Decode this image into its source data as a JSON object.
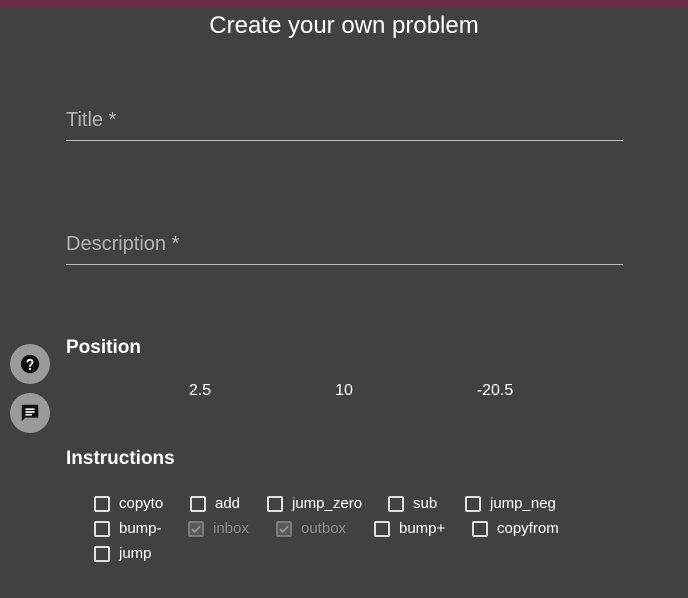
{
  "colors": {
    "accent_bar": "#6b2c49",
    "background": "#414141"
  },
  "page": {
    "title": "Create your own problem"
  },
  "form": {
    "title_placeholder": "Title *",
    "title_value": "",
    "description_placeholder": "Description *",
    "description_value": ""
  },
  "position": {
    "heading": "Position",
    "values": [
      "2.5",
      "10",
      "-20.5"
    ]
  },
  "side_buttons": {
    "help_icon": "help-icon",
    "chat_icon": "chat-icon"
  },
  "instructions": {
    "heading": "Instructions",
    "items": [
      {
        "label": "copyto",
        "checked": false,
        "disabled": false
      },
      {
        "label": "add",
        "checked": false,
        "disabled": false
      },
      {
        "label": "jump_zero",
        "checked": false,
        "disabled": false
      },
      {
        "label": "sub",
        "checked": false,
        "disabled": false
      },
      {
        "label": "jump_neg",
        "checked": false,
        "disabled": false
      },
      {
        "label": "bump-",
        "checked": false,
        "disabled": false
      },
      {
        "label": "inbox",
        "checked": true,
        "disabled": true
      },
      {
        "label": "outbox",
        "checked": true,
        "disabled": true
      },
      {
        "label": "bump+",
        "checked": false,
        "disabled": false
      },
      {
        "label": "copyfrom",
        "checked": false,
        "disabled": false
      },
      {
        "label": "jump",
        "checked": false,
        "disabled": false
      }
    ]
  }
}
